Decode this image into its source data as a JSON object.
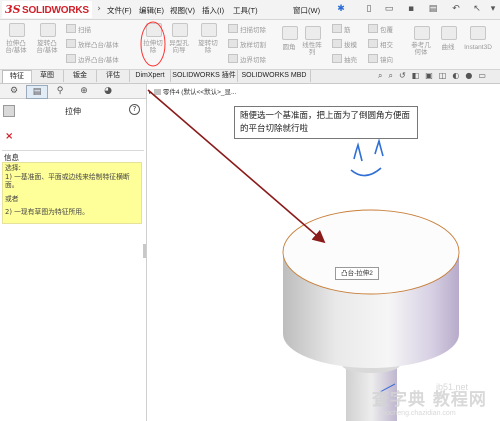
{
  "app": {
    "logo_prefix": "3S",
    "logo_name": "SOLIDWORKS"
  },
  "menu": [
    "文件(F)",
    "编辑(E)",
    "视图(V)",
    "插入(I)",
    "工具(T)",
    "窗口(W)"
  ],
  "ribbon": {
    "col1": [
      "拉伸凸",
      "台/基体"
    ],
    "col2": [
      "旋转凸",
      "台/基体"
    ],
    "col3": [
      "扫描",
      "放样凸台/基体",
      "边界凸台/基体"
    ],
    "col4": [
      "拉伸切",
      "除"
    ],
    "col5": [
      "异型孔",
      "向导"
    ],
    "col6": [
      "旋转切",
      "除"
    ],
    "col7": [
      "扫描切除",
      "放样切割",
      "边界切除"
    ],
    "col8": [
      "圆角"
    ],
    "col9": [
      "线性阵",
      "列"
    ],
    "col10": [
      "筋",
      "拔模",
      "抽壳"
    ],
    "col11": [
      "包覆",
      "相交",
      "镜向"
    ],
    "col12": [
      "参考几",
      "何体"
    ],
    "col13": [
      "曲线"
    ],
    "col14": [
      "Instant3D"
    ]
  },
  "tabs": [
    "特征",
    "草图",
    "钣金",
    "评估",
    "DimXpert",
    "SOLIDWORKS 插件",
    "SOLIDWORKS MBD"
  ],
  "panel": {
    "feature_name": "拉伸",
    "help_symbol": "?",
    "cancel_symbol": "×",
    "info_title": "信息",
    "info_select": "选择:",
    "info_line1": "1) 一基准面、平面或边线来绘制特征横断面。",
    "info_or": "或者",
    "info_line2": "2) 一现有草图为特征所用。"
  },
  "tree": {
    "item": "零件4 (默认<<默认>_显..."
  },
  "annotation": "随便选一个基准面，把上面为了倒圆角方便面的平台切除就行啦",
  "tooltip": "凸台-拉伸2",
  "watermark": {
    "site": "jb51.net",
    "brand": "查字典 教程网",
    "url": "jiaocheng.chazidian.com"
  },
  "colors": {
    "logo_red": "#d0202a",
    "arrow": "#8b1a1a",
    "highlight": "#ff3030",
    "info_bg": "#ffff99",
    "smiley": "#2f6fd6"
  }
}
